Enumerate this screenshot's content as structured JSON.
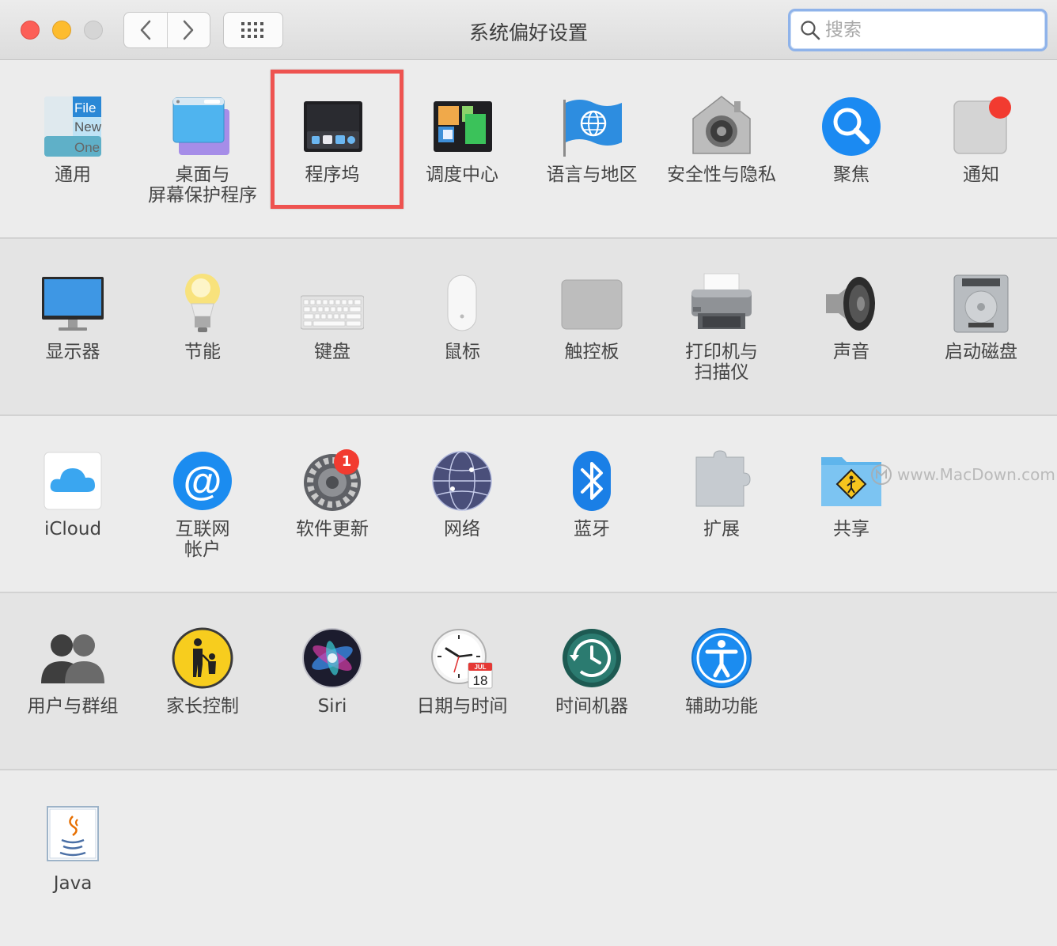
{
  "window": {
    "title": "系统偏好设置",
    "search_placeholder": "搜索"
  },
  "watermark": "www.MacDown.com",
  "sections": [
    {
      "panes": [
        {
          "id": "general",
          "label": "通用",
          "icon": "general-icon"
        },
        {
          "id": "desktop",
          "label": "桌面与\n屏幕保护程序",
          "icon": "desktop-screensaver-icon"
        },
        {
          "id": "dock",
          "label": "程序坞",
          "icon": "dock-icon",
          "highlighted": true
        },
        {
          "id": "mission",
          "label": "调度中心",
          "icon": "mission-control-icon"
        },
        {
          "id": "language",
          "label": "语言与地区",
          "icon": "language-region-icon"
        },
        {
          "id": "security",
          "label": "安全性与隐私",
          "icon": "security-privacy-icon"
        },
        {
          "id": "spotlight",
          "label": "聚焦",
          "icon": "spotlight-icon"
        },
        {
          "id": "notifications",
          "label": "通知",
          "icon": "notifications-icon"
        }
      ]
    },
    {
      "panes": [
        {
          "id": "displays",
          "label": "显示器",
          "icon": "displays-icon"
        },
        {
          "id": "energy",
          "label": "节能",
          "icon": "energy-saver-icon"
        },
        {
          "id": "keyboard",
          "label": "键盘",
          "icon": "keyboard-icon"
        },
        {
          "id": "mouse",
          "label": "鼠标",
          "icon": "mouse-icon"
        },
        {
          "id": "trackpad",
          "label": "触控板",
          "icon": "trackpad-icon"
        },
        {
          "id": "printers",
          "label": "打印机与\n扫描仪",
          "icon": "printer-scanner-icon"
        },
        {
          "id": "sound",
          "label": "声音",
          "icon": "sound-icon"
        },
        {
          "id": "startup",
          "label": "启动磁盘",
          "icon": "startup-disk-icon"
        }
      ]
    },
    {
      "panes": [
        {
          "id": "icloud",
          "label": "iCloud",
          "icon": "icloud-icon"
        },
        {
          "id": "internet",
          "label": "互联网\n帐户",
          "icon": "internet-accounts-icon"
        },
        {
          "id": "update",
          "label": "软件更新",
          "icon": "software-update-icon",
          "badge": "1"
        },
        {
          "id": "network",
          "label": "网络",
          "icon": "network-icon"
        },
        {
          "id": "bluetooth",
          "label": "蓝牙",
          "icon": "bluetooth-icon"
        },
        {
          "id": "extensions",
          "label": "扩展",
          "icon": "extensions-icon"
        },
        {
          "id": "sharing",
          "label": "共享",
          "icon": "sharing-icon"
        }
      ]
    },
    {
      "panes": [
        {
          "id": "users",
          "label": "用户与群组",
          "icon": "users-groups-icon"
        },
        {
          "id": "parental",
          "label": "家长控制",
          "icon": "parental-controls-icon"
        },
        {
          "id": "siri",
          "label": "Siri",
          "icon": "siri-icon"
        },
        {
          "id": "datetime",
          "label": "日期与时间",
          "icon": "date-time-icon",
          "cal_month": "JUL",
          "cal_day": "18"
        },
        {
          "id": "timemachine",
          "label": "时间机器",
          "icon": "time-machine-icon"
        },
        {
          "id": "accessibility",
          "label": "辅助功能",
          "icon": "accessibility-icon"
        }
      ]
    },
    {
      "panes": [
        {
          "id": "java",
          "label": "Java",
          "icon": "java-icon"
        }
      ]
    }
  ],
  "icon_text": {
    "general_file": "File",
    "general_new": "New",
    "general_one": "One"
  },
  "colors": {
    "highlight": "#ee5350",
    "badge": "#f23b30"
  }
}
